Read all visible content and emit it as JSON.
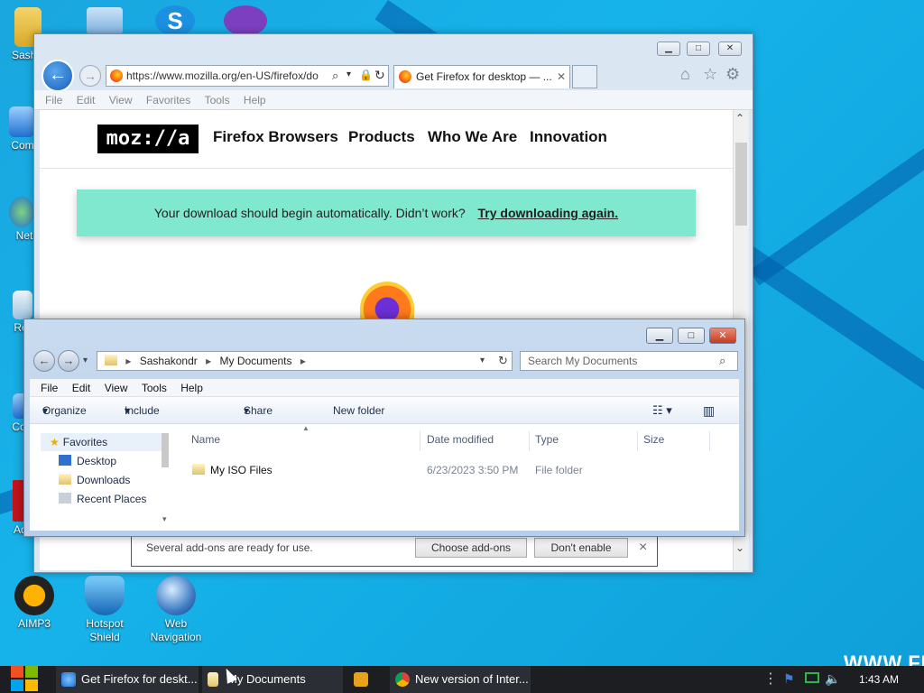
{
  "desktop": {
    "icons": [
      {
        "label": "Sasha"
      },
      {
        "label": "Com"
      },
      {
        "label": "Net"
      },
      {
        "label": "Rec"
      },
      {
        "label": "Com"
      },
      {
        "label": "Adol"
      },
      {
        "label": "AIMP3"
      },
      {
        "label": "Hotspot Shield"
      },
      {
        "label": "Web Navigation"
      }
    ],
    "watermark": "WWW.FR"
  },
  "ie": {
    "url": "https://www.mozilla.org/en-US/firefox/do",
    "tab_title": "Get Firefox for desktop — ...",
    "menu": [
      "File",
      "Edit",
      "View",
      "Favorites",
      "Tools",
      "Help"
    ],
    "page": {
      "logo": "moz://a",
      "nav": [
        "Firefox Browsers",
        "Products",
        "Who We Are",
        "Innovation"
      ],
      "banner_text": "Your download should begin automatically. Didn’t work?",
      "banner_link": "Try downloading again."
    },
    "notification": {
      "text": "Several add-ons are ready for use.",
      "choose": "Choose add-ons",
      "dont": "Don't enable",
      "close": "×"
    }
  },
  "explorer": {
    "breadcrumb": [
      "Sashakondr",
      "My Documents"
    ],
    "search_placeholder": "Search My Documents",
    "menu": [
      "File",
      "Edit",
      "View",
      "Tools",
      "Help"
    ],
    "toolbar": {
      "organize": "Organize",
      "include": "Include in library",
      "share": "Share with",
      "newfolder": "New folder"
    },
    "sidebar": [
      {
        "label": "Favorites"
      },
      {
        "label": "Desktop"
      },
      {
        "label": "Downloads"
      },
      {
        "label": "Recent Places"
      }
    ],
    "columns": {
      "name": "Name",
      "date": "Date modified",
      "type": "Type",
      "size": "Size"
    },
    "files": [
      {
        "name": "My ISO Files",
        "date": "6/23/2023 3:50 PM",
        "type": "File folder",
        "size": ""
      }
    ]
  },
  "taskbar": {
    "items": [
      {
        "label": "Get Firefox for deskt..."
      },
      {
        "label": "My Documents"
      },
      {
        "label": ""
      },
      {
        "label": "New version of Inter..."
      }
    ],
    "clock": "1:43 AM"
  },
  "colors": {
    "accent": "#1aa6df",
    "banner": "#7fe8cf",
    "close_red": "#c33b22"
  }
}
